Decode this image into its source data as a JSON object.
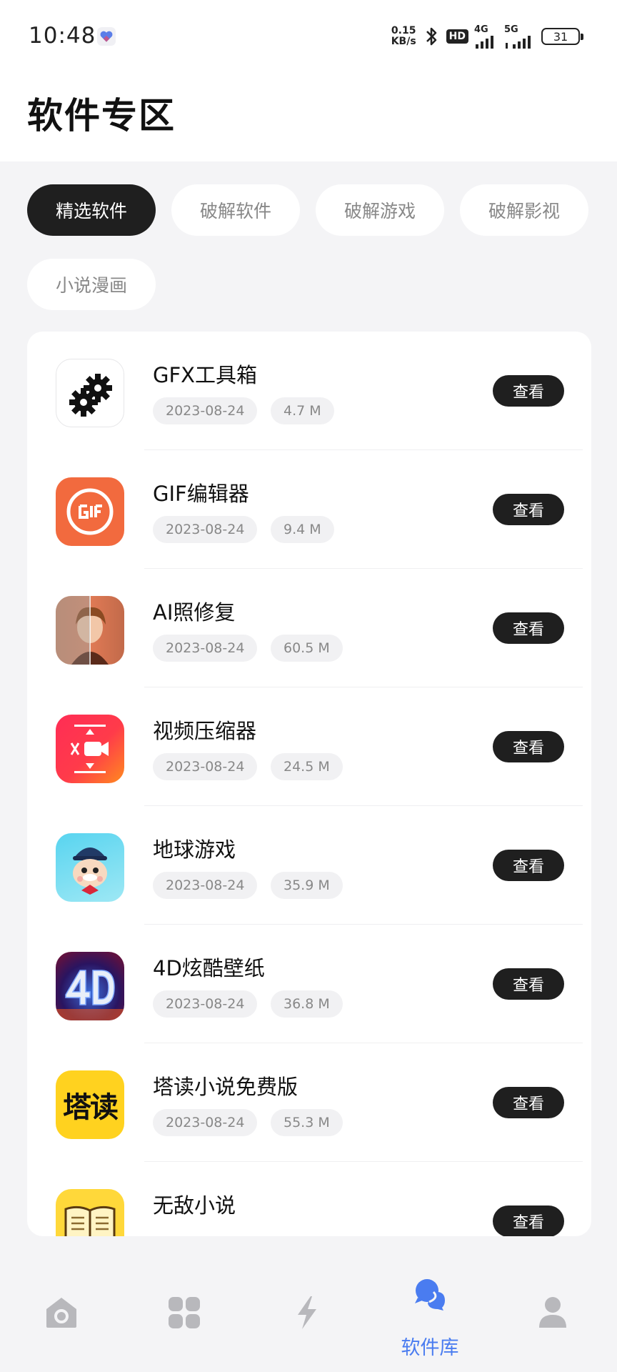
{
  "status_bar": {
    "time": "10:48",
    "net_speed_value": "0.15",
    "net_speed_unit": "KB/s",
    "hd_label": "HD",
    "signal1_label": "4G",
    "signal2_label": "5G",
    "battery": "31"
  },
  "page": {
    "title": "软件专区"
  },
  "categories": [
    {
      "label": "精选软件",
      "active": true
    },
    {
      "label": "破解软件",
      "active": false
    },
    {
      "label": "破解游戏",
      "active": false
    },
    {
      "label": "破解影视",
      "active": false
    },
    {
      "label": "小说漫画",
      "active": false
    }
  ],
  "apps": [
    {
      "name": "GFX工具箱",
      "date": "2023-08-24",
      "size": "4.7 M",
      "action": "查看",
      "icon": "gear-icon"
    },
    {
      "name": "GIF编辑器",
      "date": "2023-08-24",
      "size": "9.4 M",
      "action": "查看",
      "icon": "gif-icon"
    },
    {
      "name": "AI照修复",
      "date": "2023-08-24",
      "size": "60.5 M",
      "action": "查看",
      "icon": "portrait-icon"
    },
    {
      "name": "视频压缩器",
      "date": "2023-08-24",
      "size": "24.5 M",
      "action": "查看",
      "icon": "video-compress-icon"
    },
    {
      "name": "地球游戏",
      "date": "2023-08-24",
      "size": "35.9 M",
      "action": "查看",
      "icon": "game-character-icon"
    },
    {
      "name": "4D炫酷壁纸",
      "date": "2023-08-24",
      "size": "36.8 M",
      "action": "查看",
      "icon": "wallpaper-4d-icon"
    },
    {
      "name": "塔读小说免费版",
      "date": "2023-08-24",
      "size": "55.3 M",
      "action": "查看",
      "icon": "tadu-icon",
      "icon_text": "塔读"
    },
    {
      "name": "无敌小说",
      "date": "",
      "size": "",
      "action": "查看",
      "icon": "book-icon"
    }
  ],
  "tabbar": {
    "active_label": "软件库",
    "active_color": "#4a7cf0",
    "inactive_color": "#b8b8bc"
  }
}
